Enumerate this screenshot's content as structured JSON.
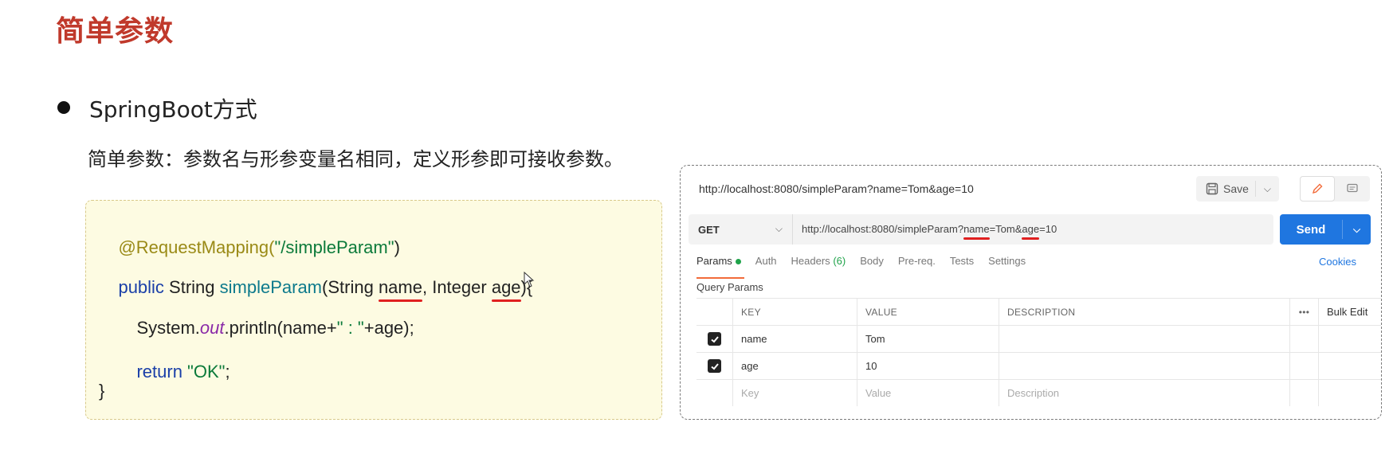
{
  "slide": {
    "title": "简单参数",
    "bullet": "SpringBoot方式",
    "description": "简单参数：参数名与形参变量名相同，定义形参即可接收参数。"
  },
  "code": {
    "line1_annotation": "@RequestMapping(",
    "line1_string": "\"/simpleParam\"",
    "line1_close": ")",
    "line2_kw": "public",
    "line2_type": " String ",
    "line2_method": "simpleParam",
    "line2_sig_open": "(String ",
    "line2_param1": "name",
    "line2_sig_mid": ", Integer ",
    "line2_param2": "age",
    "line2_sig_close": "){",
    "line3_prefix": "System.",
    "line3_field": "out",
    "line3_call": ".println(name+",
    "line3_string": "\" : \"",
    "line3_end": "+age);",
    "line4_kw": "return",
    "line4_string": " \"OK\"",
    "line4_end": ";",
    "line5": "}"
  },
  "postman": {
    "request_title": "http://localhost:8080/simpleParam?name=Tom&age=10",
    "save_label": "Save",
    "method": "GET",
    "url_prefix": "http://localhost:8080/simpleParam?",
    "url_key1": "name",
    "url_eq1": "=Tom&",
    "url_key2": "age",
    "url_eq2": "=10",
    "send_label": "Send",
    "tabs": [
      {
        "label": "Params",
        "active": true
      },
      {
        "label": "Auth"
      },
      {
        "label": "Headers",
        "count": "(6)"
      },
      {
        "label": "Body"
      },
      {
        "label": "Pre-req."
      },
      {
        "label": "Tests"
      },
      {
        "label": "Settings"
      }
    ],
    "cookies_label": "Cookies",
    "query_params_label": "Query Params",
    "table": {
      "headers": {
        "key": "KEY",
        "value": "VALUE",
        "description": "DESCRIPTION",
        "more": "•••",
        "bulk_edit": "Bulk Edit"
      },
      "rows": [
        {
          "checked": true,
          "key": "name",
          "value": "Tom",
          "description": ""
        },
        {
          "checked": true,
          "key": "age",
          "value": "10",
          "description": ""
        }
      ],
      "placeholder": {
        "key": "Key",
        "value": "Value",
        "description": "Description"
      }
    }
  }
}
